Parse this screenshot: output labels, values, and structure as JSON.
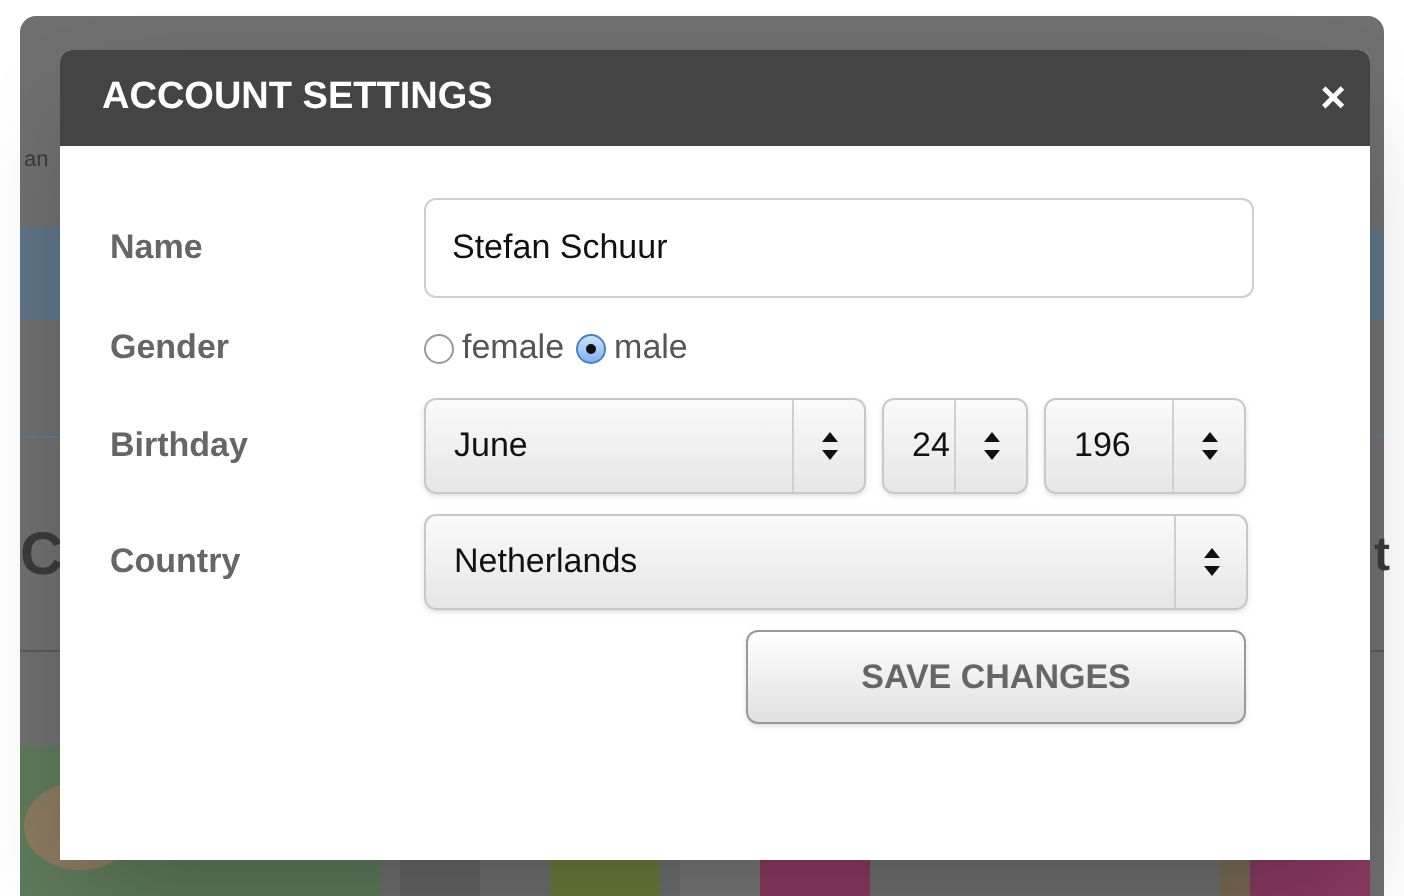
{
  "background": {
    "texts": [
      {
        "kind": "small",
        "text": "an"
      },
      {
        "kind": "heading-left",
        "text": "C"
      },
      {
        "kind": "heading-right",
        "text": "t"
      }
    ]
  },
  "dialog": {
    "title": "ACCOUNT SETTINGS",
    "close": "×",
    "fields": [
      {
        "kind": "text",
        "label": "Name",
        "value": "Stefan Schuur"
      },
      {
        "kind": "radio",
        "label": "Gender",
        "options": [
          {
            "label": "female",
            "selected": false
          },
          {
            "label": "male",
            "selected": true
          }
        ]
      },
      {
        "kind": "selects",
        "label": "Birthday",
        "selects": [
          {
            "value": "June"
          },
          {
            "value": "24"
          },
          {
            "value": "196"
          }
        ]
      },
      {
        "kind": "select",
        "label": "Country",
        "value": "Netherlands"
      }
    ],
    "submit": "SAVE CHANGES"
  }
}
